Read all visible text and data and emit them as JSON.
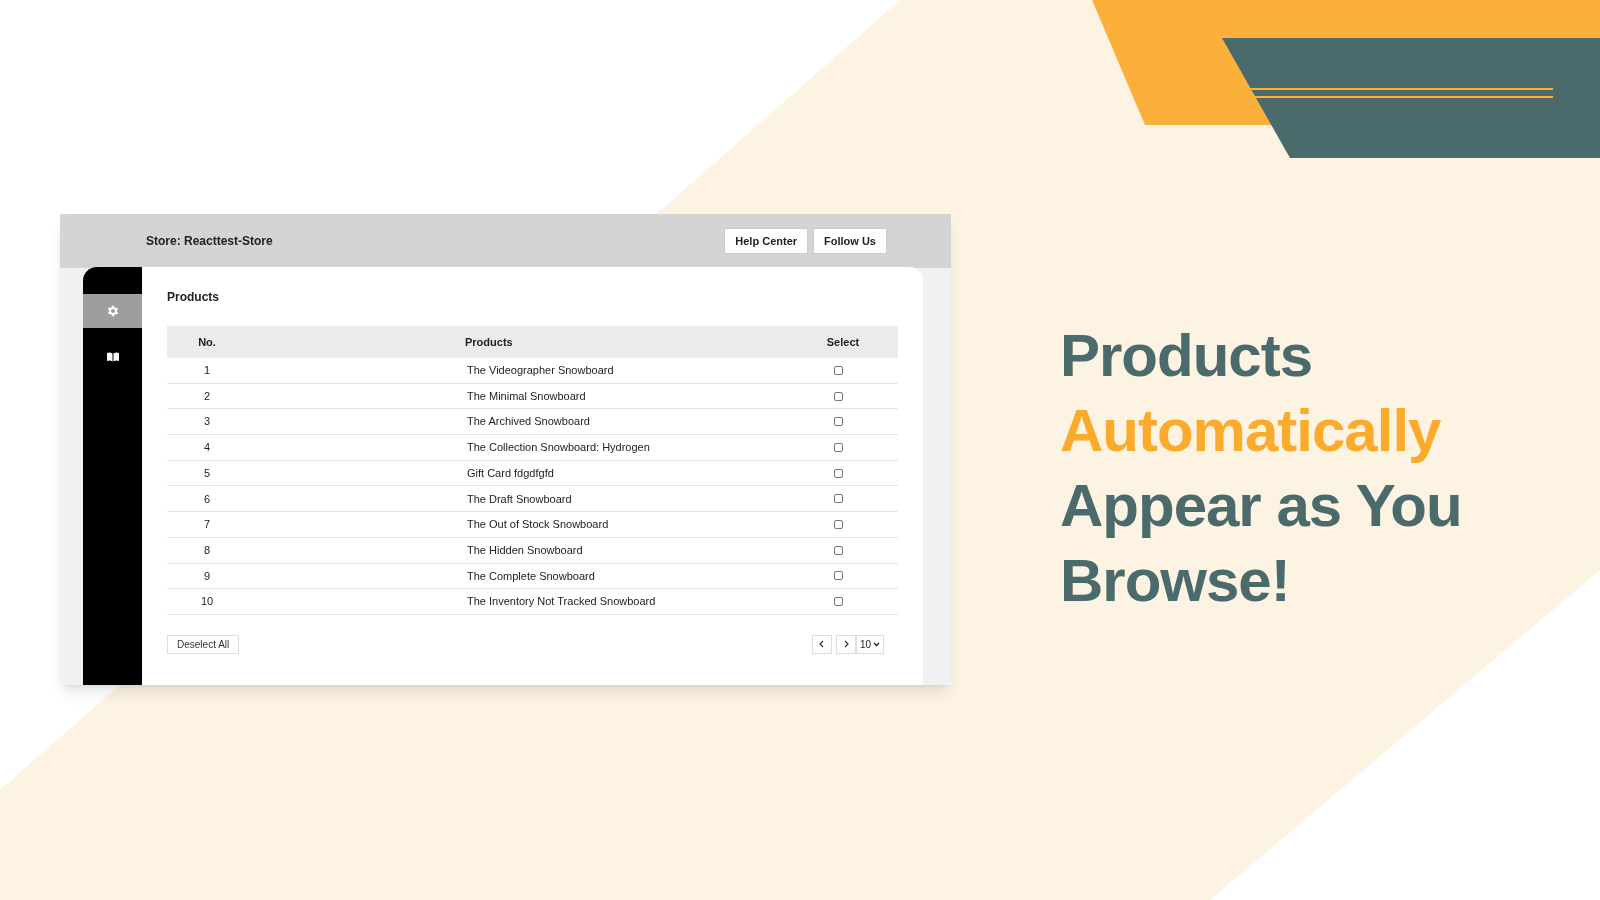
{
  "app": {
    "store_label": "Store: Reacttest-Store",
    "header_buttons": [
      "Help Center",
      "Follow Us"
    ],
    "sidebar": {
      "items": [
        {
          "kind": "settings",
          "selected": true
        },
        {
          "kind": "book",
          "selected": false
        }
      ]
    },
    "section_title": "Products",
    "table": {
      "columns": [
        "No.",
        "Products",
        "Select"
      ],
      "rows": [
        {
          "no": "1",
          "product": "The Videographer Snowboard",
          "checked": false
        },
        {
          "no": "2",
          "product": "The Minimal Snowboard",
          "checked": false
        },
        {
          "no": "3",
          "product": "The Archived Snowboard",
          "checked": false
        },
        {
          "no": "4",
          "product": "The Collection Snowboard: Hydrogen",
          "checked": false
        },
        {
          "no": "5",
          "product": "Gift Card fdgdfgfd",
          "checked": false
        },
        {
          "no": "6",
          "product": "The Draft Snowboard",
          "checked": false
        },
        {
          "no": "7",
          "product": "The Out of Stock Snowboard",
          "checked": false
        },
        {
          "no": "8",
          "product": "The Hidden Snowboard",
          "checked": false
        },
        {
          "no": "9",
          "product": "The Complete Snowboard",
          "checked": false
        },
        {
          "no": "10",
          "product": "The Inventory Not Tracked Snowboard",
          "checked": false
        }
      ]
    },
    "deselect_button": "Deselect All",
    "pagination": {
      "page_size": "10"
    }
  },
  "headline": {
    "lines": [
      {
        "text": "Products",
        "highlighted": false
      },
      {
        "text": "Automatically",
        "highlighted": true
      },
      {
        "text": "Appear as You",
        "highlighted": false
      },
      {
        "text": "Browse!",
        "highlighted": false
      }
    ]
  }
}
